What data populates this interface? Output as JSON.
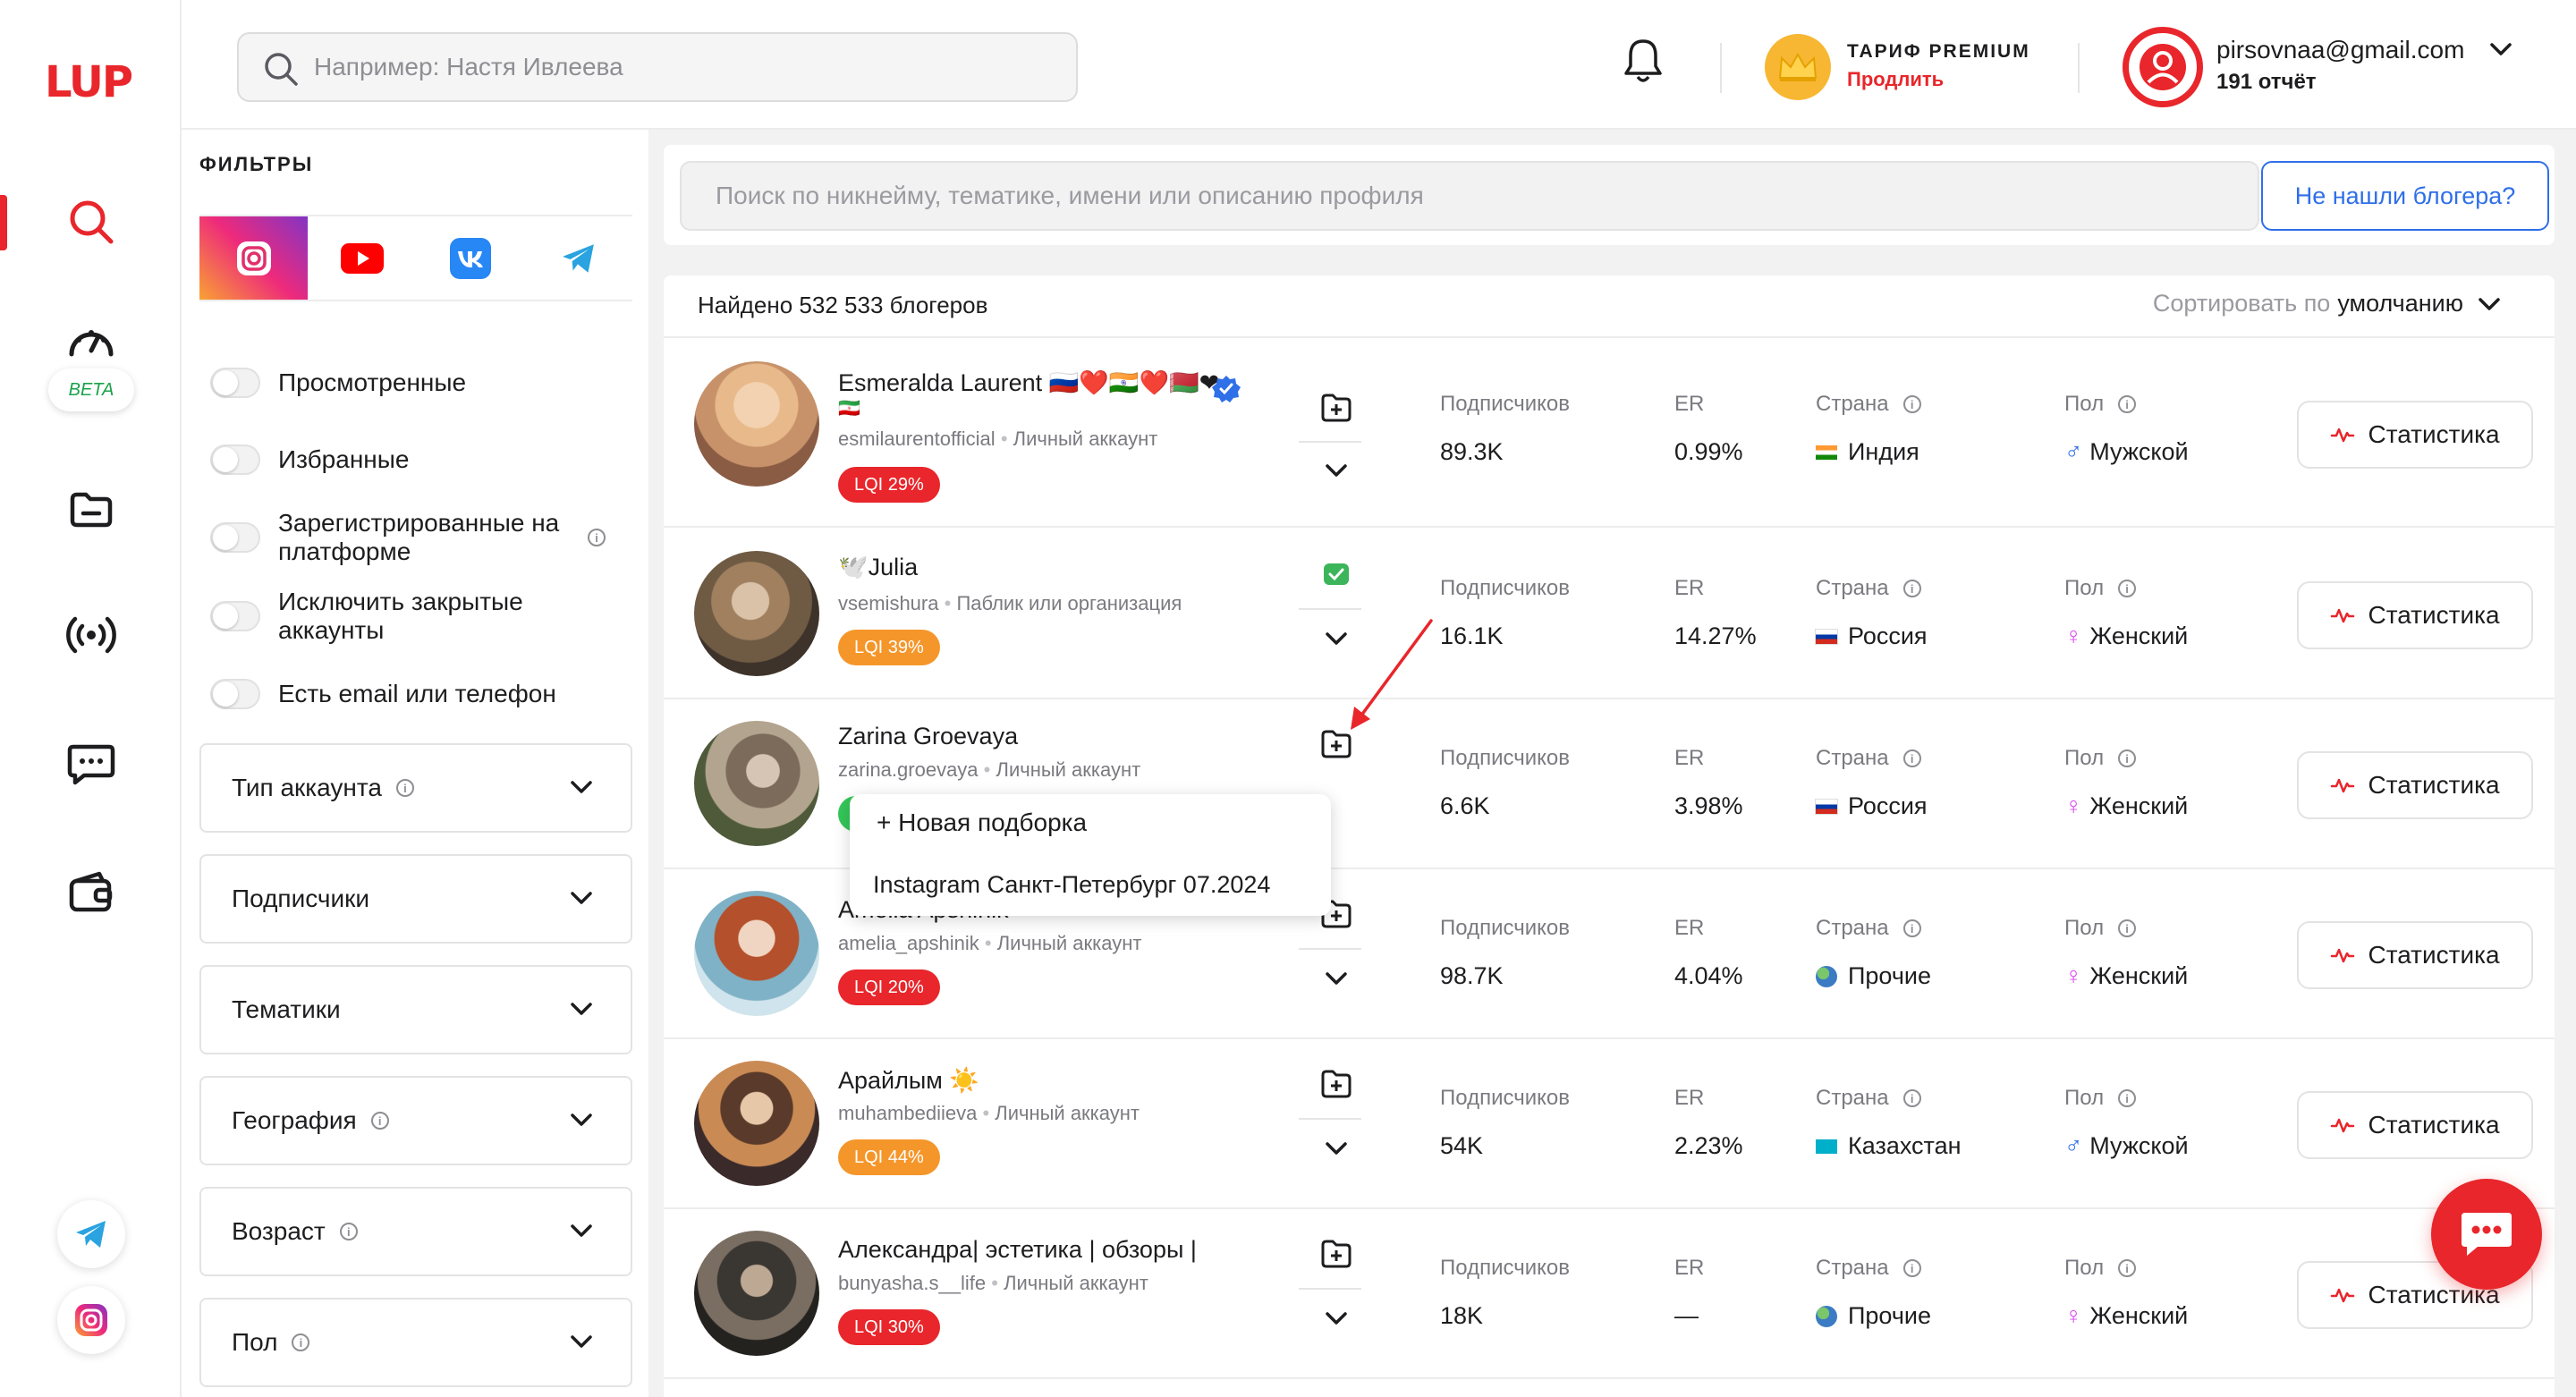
{
  "brand": {
    "logo_text": "LUP"
  },
  "rail": {
    "beta_label": "BETA"
  },
  "header": {
    "search_placeholder": "Например: Настя Ивлеева",
    "tariff_title": "ТАРИФ PREMIUM",
    "tariff_link": "Продлить",
    "user_email": "pirsovnaa@gmail.com",
    "reports": "191 отчёт"
  },
  "filters": {
    "title": "ФИЛЬТРЫ",
    "toggles": [
      "Просмотренные",
      "Избранные",
      "Зарегистрированные на платформе",
      "Исключить закрытые аккаунты",
      "Есть email или телефон"
    ],
    "dropdowns": [
      "Тип аккаунта",
      "Подписчики",
      "Тематики",
      "География",
      "Возраст",
      "Пол"
    ]
  },
  "main": {
    "search_placeholder": "Поиск по никнейму, тематике, имени или описанию профиля",
    "not_found_button": "Не нашли блогера?",
    "found_text": "Найдено 532 533 блогеров",
    "sort_label": "Сортировать по",
    "sort_value": "умолчанию",
    "col_subscribers": "Подписчиков",
    "col_er": "ER",
    "col_country": "Страна",
    "col_gender": "Пол",
    "stats_button": "Статистика"
  },
  "bloggers": [
    {
      "name": "Esmeralda Laurent 🇷🇺❤️🇮🇳❤️🇧🇾❤",
      "name2": "🇮🇷",
      "handle": "esmilaurentofficial",
      "type": "Личный аккаунт",
      "lqi": "LQI 29%",
      "lqi_color": "#e8262b",
      "subs": "89.3K",
      "er": "0.99%",
      "country": "Индия",
      "gender": "Мужской",
      "gender_symbol": "♂",
      "gender_color": "#2f6fe8"
    },
    {
      "name": "🕊️Julia",
      "handle": "vsemishura",
      "type": "Паблик или организация",
      "lqi": "LQI 39%",
      "lqi_color": "#f5962a",
      "subs": "16.1K",
      "er": "14.27%",
      "country": "Россия",
      "gender": "Женский",
      "gender_symbol": "♀",
      "gender_color": "#d946ef"
    },
    {
      "name": "Zarina Groevaya",
      "handle": "zarina.groevaya",
      "type": "Личный аккаунт",
      "lqi": "",
      "lqi_color": "#34c759",
      "subs": "6.6K",
      "er": "3.98%",
      "country": "Россия",
      "gender": "Женский",
      "gender_symbol": "♀",
      "gender_color": "#d946ef"
    },
    {
      "name": "Amelia Apshinik",
      "handle": "amelia_apshinik",
      "type": "Личный аккаунт",
      "lqi": "LQI 20%",
      "lqi_color": "#e8262b",
      "subs": "98.7K",
      "er": "4.04%",
      "country": "Прочие",
      "gender": "Женский",
      "gender_symbol": "♀",
      "gender_color": "#d946ef"
    },
    {
      "name": "Арайлым ☀️",
      "handle": "muhambediieva",
      "type": "Личный аккаунт",
      "lqi": "LQI 44%",
      "lqi_color": "#f5962a",
      "subs": "54K",
      "er": "2.23%",
      "country": "Казахстан",
      "gender": "Мужской",
      "gender_symbol": "♂",
      "gender_color": "#2f6fe8"
    },
    {
      "name": "Александра| эстетика | обзоры |",
      "handle": "bunyasha.s__life",
      "type": "Личный аккаунт",
      "lqi": "LQI 30%",
      "lqi_color": "#e8262b",
      "subs": "18K",
      "er": "—",
      "country": "Прочие",
      "gender": "Женский",
      "gender_symbol": "♀",
      "gender_color": "#d946ef"
    }
  ],
  "popup": {
    "new_collection": "+ Новая подборка",
    "collection_item": "Instagram Санкт-Петербург 07.2024"
  }
}
